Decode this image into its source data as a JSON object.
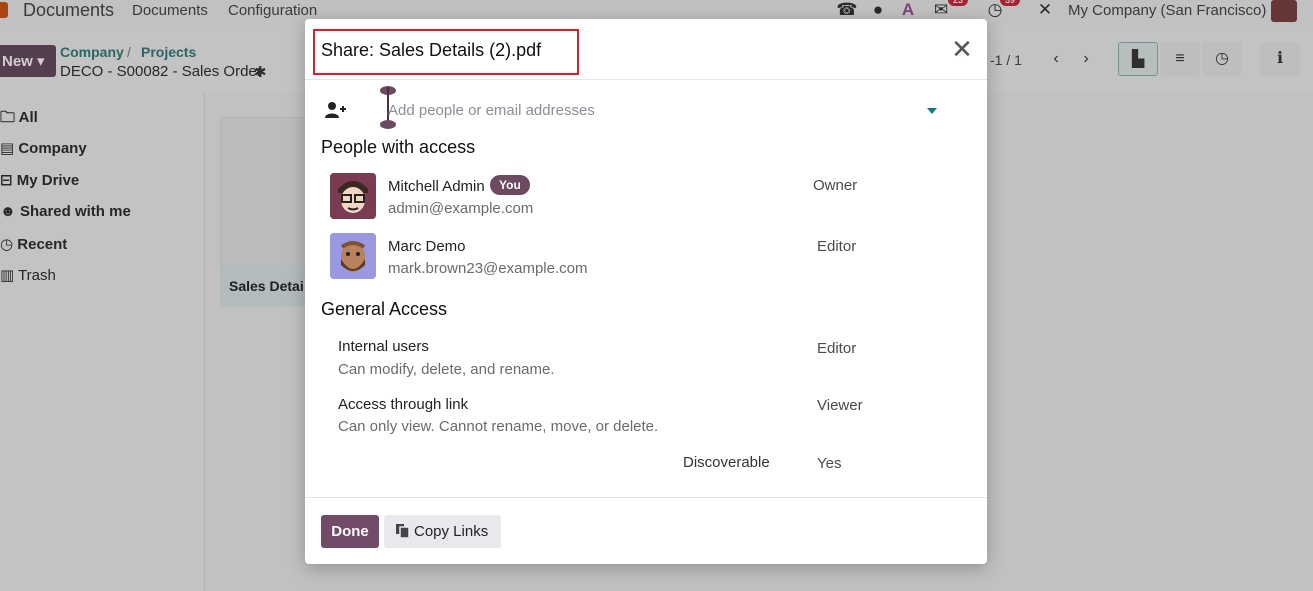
{
  "topbar": {
    "app_name": "Documents",
    "menu_documents": "Documents",
    "menu_configuration": "Configuration",
    "messages_badge": "23",
    "activity_badge": "39",
    "company": "My Company (San Francisco)"
  },
  "controlbar": {
    "new_label": "New",
    "breadcrumb_company": "Company",
    "breadcrumb_sep": "/",
    "breadcrumb_projects": "Projects",
    "record_title": "DECO - S00082 - Sales Order",
    "pager": "-1 / 1"
  },
  "sidebar": {
    "items": [
      "All",
      "Company",
      "My Drive",
      "Shared with me",
      "Recent",
      "Trash"
    ]
  },
  "card": {
    "name": "Sales Detai"
  },
  "modal": {
    "title": "Share: Sales Details (2).pdf",
    "add_placeholder": "Add people or email addresses",
    "people_title": "People with access",
    "people": [
      {
        "name": "Mitchell Admin",
        "badge": "You",
        "email": "admin@example.com",
        "role": "Owner"
      },
      {
        "name": "Marc Demo",
        "email": "mark.brown23@example.com",
        "role": "Editor"
      }
    ],
    "general_title": "General Access",
    "general": [
      {
        "label": "Internal users",
        "desc": "Can modify, delete, and rename.",
        "value": "Editor"
      },
      {
        "label": "Access through link",
        "desc": "Can only view. Cannot rename, move, or delete.",
        "value": "Viewer"
      }
    ],
    "discoverable_label": "Discoverable",
    "discoverable_value": "Yes",
    "done_label": "Done",
    "copy_label": "Copy Links"
  },
  "colors": {
    "primary": "#714b67",
    "highlight": "#d6202e",
    "accent": "#0f7a80"
  }
}
